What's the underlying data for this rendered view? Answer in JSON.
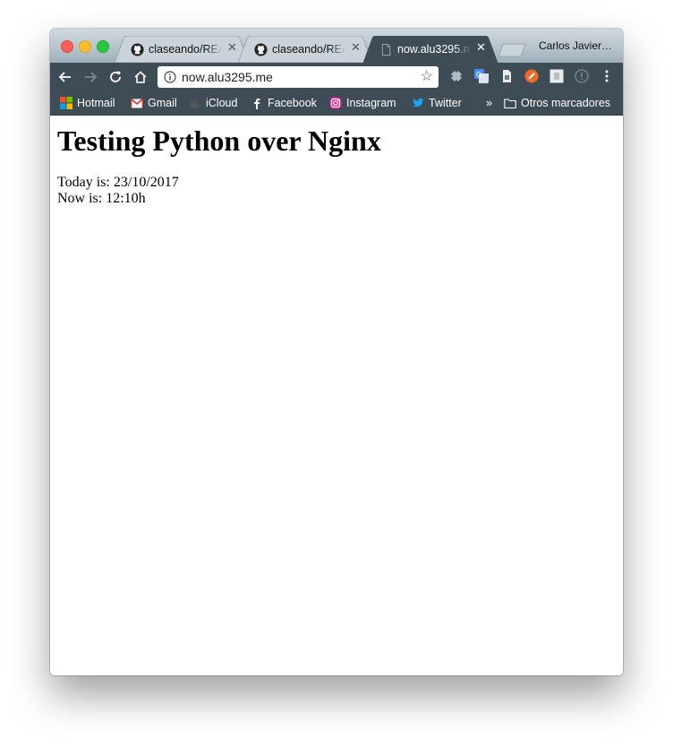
{
  "tabs": [
    {
      "title": "claseando/README.md",
      "icon": "github-icon",
      "active": false
    },
    {
      "title": "claseando/README.md",
      "icon": "github-icon",
      "active": false
    },
    {
      "title": "now.alu3295.me",
      "icon": "page-icon",
      "active": true
    }
  ],
  "profile_name": "Carlos Javier…",
  "toolbar": {
    "url": "now.alu3295.me",
    "extensions": [
      "puzzle-extension-icon",
      "translate-extension-icon",
      "file-extension-icon",
      "orange-extension-icon",
      "square-extension-icon",
      "info-extension-icon"
    ]
  },
  "bookmarks": [
    {
      "label": "Hotmail",
      "icon": "microsoft-icon"
    },
    {
      "label": "Gmail",
      "icon": "gmail-icon"
    },
    {
      "label": "iCloud",
      "icon": "apple-icon"
    },
    {
      "label": "Facebook",
      "icon": "facebook-icon"
    },
    {
      "label": "Instagram",
      "icon": "instagram-icon"
    },
    {
      "label": "Twitter",
      "icon": "twitter-icon"
    }
  ],
  "bookmarks_overflow": "»",
  "other_bookmarks": "Otros marcadores",
  "page": {
    "heading": "Testing Python over Nginx",
    "today": "Today is: 23/10/2017",
    "now": "Now is: 12:10h"
  },
  "colors": {
    "toolbar": "#3e4c56",
    "titlebar": "#b7c4cc",
    "traffic_red": "#fc5f57",
    "traffic_yellow": "#fdbc2e",
    "traffic_green": "#28c940"
  }
}
